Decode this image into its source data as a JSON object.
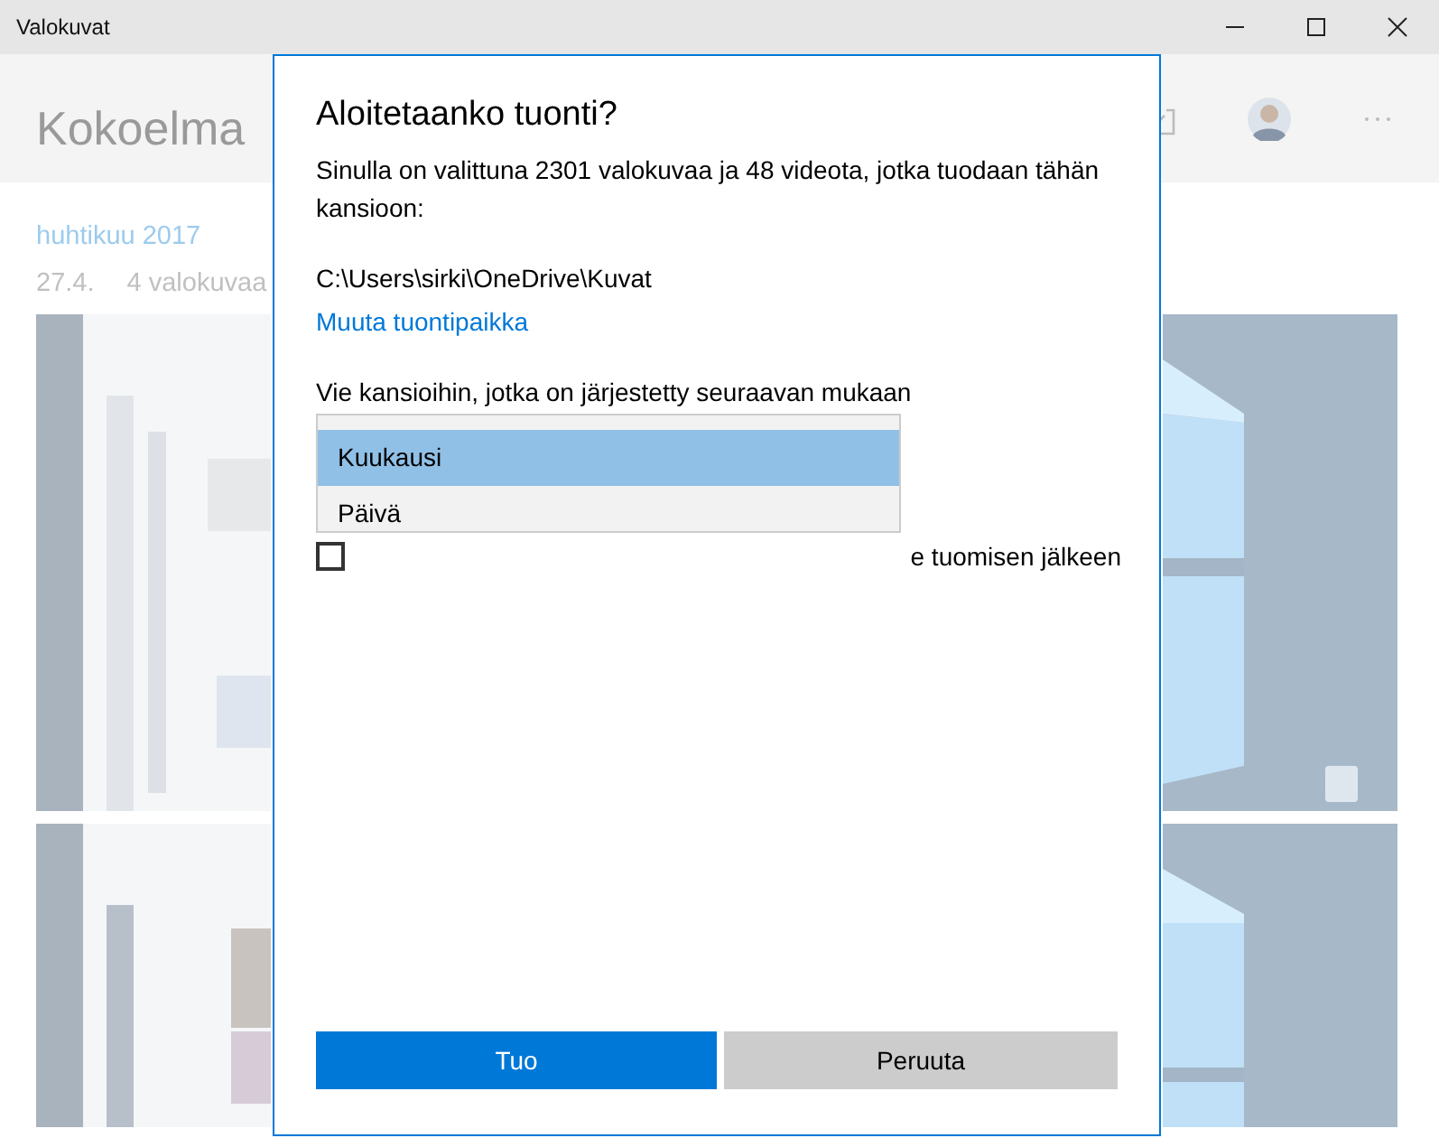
{
  "window": {
    "title": "Valokuvat"
  },
  "app": {
    "page_title": "Kokoelma",
    "group": {
      "month": "huhtikuu 2017",
      "date": "27.4.",
      "count": "4 valokuvaa"
    }
  },
  "dialog": {
    "title": "Aloitetaanko tuonti?",
    "message": "Sinulla on valittuna 2301 valokuvaa ja 48 videota, jotka tuodaan tähän kansioon:",
    "path": "C:\\Users\\sirki\\OneDrive\\Kuvat",
    "change_link": "Muuta tuontipaikka",
    "folder_label": "Vie kansioihin, jotka on järjestetty seuraavan mukaan",
    "dropdown_options": [
      {
        "label": "Kuukausi",
        "selected": true
      },
      {
        "label": "Päivä",
        "selected": false
      }
    ],
    "checkbox": {
      "label": "e tuomisen jälkeen",
      "checked": false
    },
    "buttons": [
      {
        "label": "Tuo",
        "kind": "primary"
      },
      {
        "label": "Peruuta",
        "kind": "secondary"
      }
    ]
  }
}
